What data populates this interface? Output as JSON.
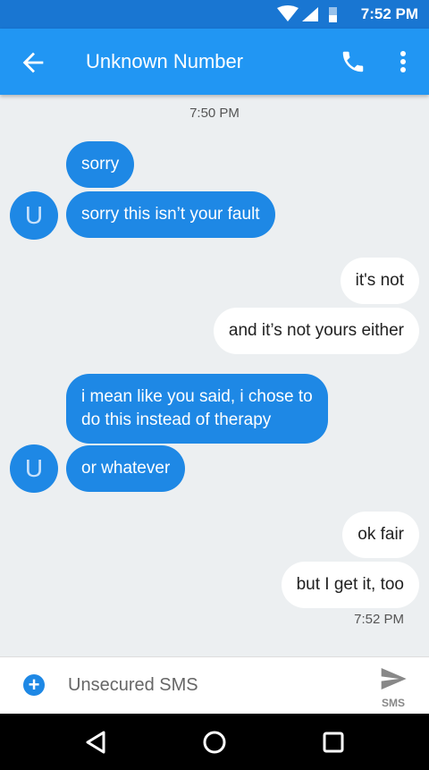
{
  "status_bar": {
    "time": "7:52 PM"
  },
  "app_bar": {
    "title": "Unknown Number"
  },
  "conversation": {
    "timestamp_top": "7:50 PM",
    "avatar_letter": "U",
    "messages": [
      {
        "direction": "incoming",
        "text": "sorry"
      },
      {
        "direction": "incoming",
        "text": "sorry this isn’t your fault"
      },
      {
        "direction": "outgoing",
        "text": "it's not"
      },
      {
        "direction": "outgoing",
        "text": "and it’s not yours either"
      },
      {
        "direction": "incoming",
        "text_lines": [
          "i mean like you said, i chose to",
          "do this instead of therapy"
        ]
      },
      {
        "direction": "incoming",
        "text": "or whatever"
      },
      {
        "direction": "outgoing",
        "text": "ok fair"
      },
      {
        "direction": "outgoing",
        "text": "but I get it, too"
      }
    ],
    "timestamp_bottom": "7:52 PM"
  },
  "compose": {
    "placeholder": "Unsecured SMS",
    "add_icon": "plus-icon",
    "send_icon": "send-icon",
    "send_label": "SMS"
  },
  "nav": {
    "back_icon": "triangle-back-icon",
    "home_icon": "circle-home-icon",
    "recents_icon": "square-recents-icon"
  },
  "colors": {
    "primary": "#2196f3",
    "primary_dark": "#1976d2",
    "incoming_bubble": "#1e88e5",
    "outgoing_bubble": "#ffffff",
    "background": "#eceff1"
  }
}
